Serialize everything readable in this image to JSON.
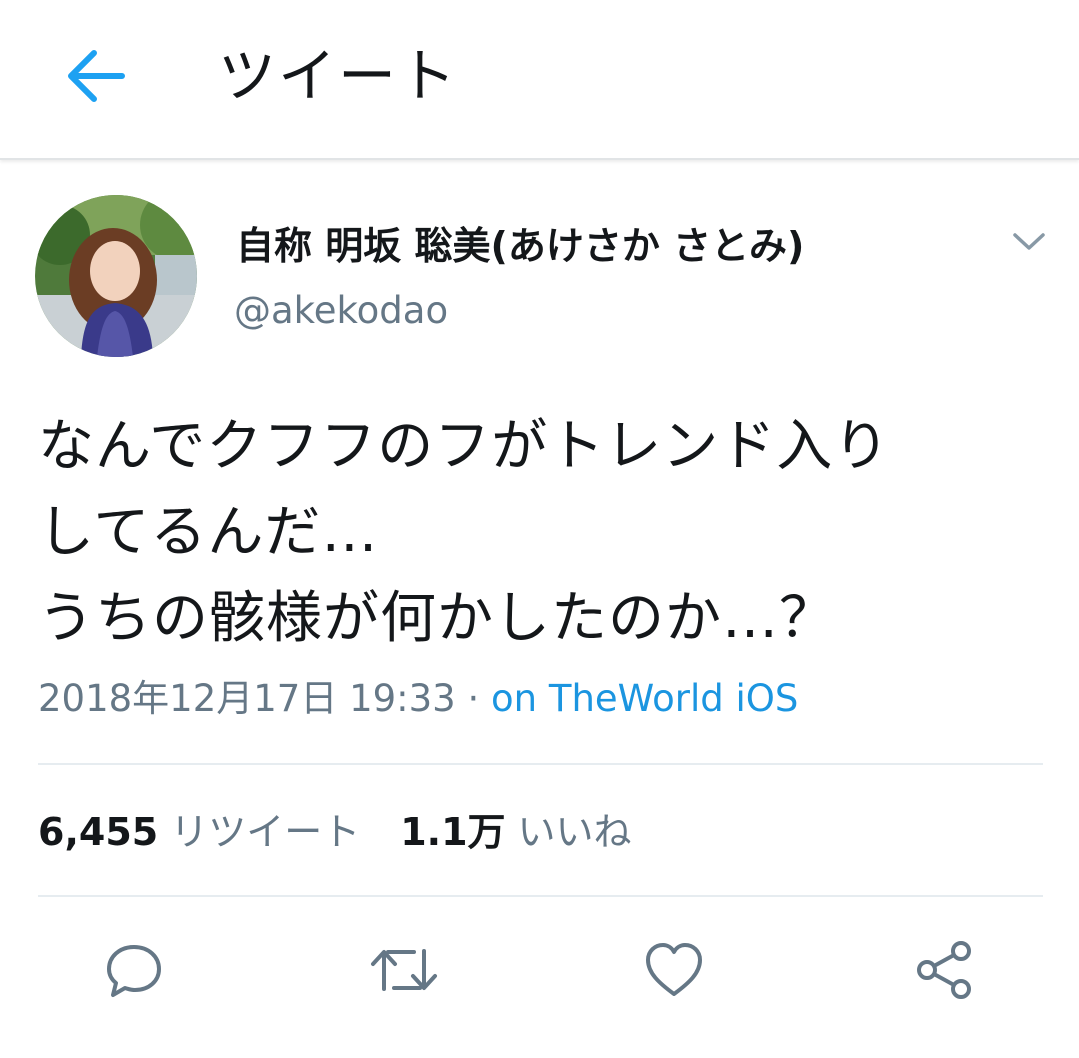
{
  "header": {
    "title": "ツイート",
    "back_icon": "arrow-left-icon"
  },
  "colors": {
    "accent": "#1da1f2",
    "link": "#1b95e0",
    "secondary_text": "#657786",
    "icon_gray": "#657786",
    "divider": "#e6ecf0"
  },
  "user": {
    "display_name": "自称 明坂 聡美(あけさか さとみ)",
    "handle": "@akekodao",
    "avatar": "avatar-photo"
  },
  "tweet": {
    "text": "なんでクフフのフがトレンド入り\nしてるんだ…\nうちの骸様が何かしたのか…？",
    "timestamp": "2018年12月17日 19:33",
    "separator": " · ",
    "source": "on TheWorld iOS"
  },
  "stats": {
    "retweets_count": "6,455",
    "retweets_label": "リツイート",
    "likes_count": "1.1万",
    "likes_label": "いいね"
  },
  "actions": [
    "reply-icon",
    "retweet-icon",
    "like-icon",
    "share-icon"
  ]
}
